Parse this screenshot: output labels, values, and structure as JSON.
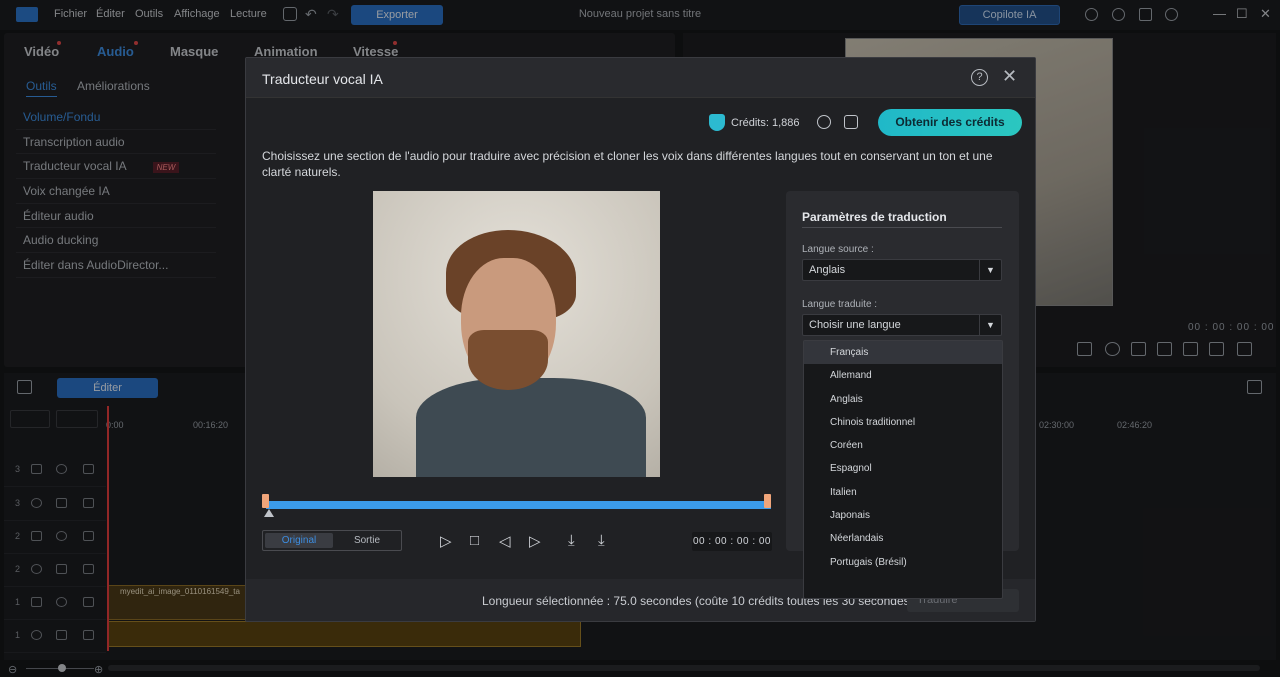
{
  "menu": [
    "Fichier",
    "Éditer",
    "Outils",
    "Affichage",
    "Lecture"
  ],
  "toolbar": {
    "export_label": "Exporter",
    "project_title": "Nouveau projet sans titre",
    "copilot_label": "Copilote IA"
  },
  "left_tabs": [
    "Vidéo",
    "Audio",
    "Masque",
    "Animation",
    "Vitesse"
  ],
  "sub_tabs": [
    "Outils",
    "Améliorations"
  ],
  "tools": [
    "Volume/Fondu",
    "Transcription audio",
    "Traducteur vocal IA",
    "Voix changée IA",
    "Éditeur audio",
    "Audio ducking",
    "Éditer dans AudioDirector..."
  ],
  "new_tag": "NEW",
  "preview": {
    "timecode": "00 : 00 : 00 : 00"
  },
  "timeline": {
    "edit_label": "Éditer",
    "ruler": [
      "0:00",
      "00:16:20",
      "02:30:00",
      "02:46:20"
    ],
    "tracks": [
      "3",
      "3",
      "2",
      "2",
      "1",
      "1"
    ],
    "clip_label": "myedit_ai_image_0110161549_ta"
  },
  "modal": {
    "title": "Traducteur vocal IA",
    "credits_text": "Crédits: 1,886",
    "get_credits": "Obtenir des crédits",
    "description": "Choisissez une section de l'audio pour traduire avec précision et cloner les voix dans différentes langues tout en conservant un ton et une clarté naturels.",
    "seg_original": "Original",
    "seg_output": "Sortie",
    "timecode": "00 : 00 : 00 : 00",
    "settings": {
      "title": "Paramètres de traduction",
      "source_label": "Langue source :",
      "source_value": "Anglais",
      "target_label": "Langue traduite :",
      "target_value": "Choisir une langue"
    },
    "languages": [
      "Français",
      "Allemand",
      "Anglais",
      "Chinois traditionnel",
      "Coréen",
      "Espagnol",
      "Italien",
      "Japonais",
      "Néerlandais",
      "Portugais (Brésil)"
    ],
    "footer_text": "Longueur sélectionnée : 75.0 secondes (coûte 10 crédits toutes les 30 secondes)",
    "translate_label": "Traduire"
  }
}
